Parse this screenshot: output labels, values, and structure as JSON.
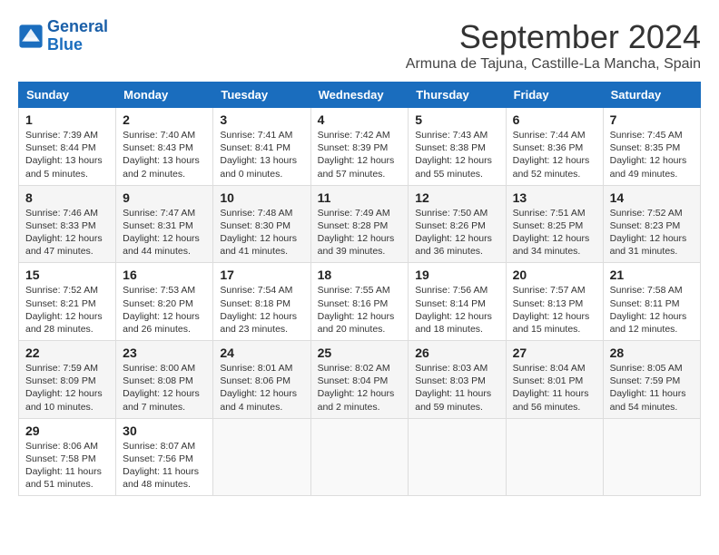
{
  "header": {
    "logo_line1": "General",
    "logo_line2": "Blue",
    "month_title": "September 2024",
    "location": "Armuna de Tajuna, Castille-La Mancha, Spain"
  },
  "days_of_week": [
    "Sunday",
    "Monday",
    "Tuesday",
    "Wednesday",
    "Thursday",
    "Friday",
    "Saturday"
  ],
  "weeks": [
    [
      {
        "day": "1",
        "info": "Sunrise: 7:39 AM\nSunset: 8:44 PM\nDaylight: 13 hours\nand 5 minutes."
      },
      {
        "day": "2",
        "info": "Sunrise: 7:40 AM\nSunset: 8:43 PM\nDaylight: 13 hours\nand 2 minutes."
      },
      {
        "day": "3",
        "info": "Sunrise: 7:41 AM\nSunset: 8:41 PM\nDaylight: 13 hours\nand 0 minutes."
      },
      {
        "day": "4",
        "info": "Sunrise: 7:42 AM\nSunset: 8:39 PM\nDaylight: 12 hours\nand 57 minutes."
      },
      {
        "day": "5",
        "info": "Sunrise: 7:43 AM\nSunset: 8:38 PM\nDaylight: 12 hours\nand 55 minutes."
      },
      {
        "day": "6",
        "info": "Sunrise: 7:44 AM\nSunset: 8:36 PM\nDaylight: 12 hours\nand 52 minutes."
      },
      {
        "day": "7",
        "info": "Sunrise: 7:45 AM\nSunset: 8:35 PM\nDaylight: 12 hours\nand 49 minutes."
      }
    ],
    [
      {
        "day": "8",
        "info": "Sunrise: 7:46 AM\nSunset: 8:33 PM\nDaylight: 12 hours\nand 47 minutes."
      },
      {
        "day": "9",
        "info": "Sunrise: 7:47 AM\nSunset: 8:31 PM\nDaylight: 12 hours\nand 44 minutes."
      },
      {
        "day": "10",
        "info": "Sunrise: 7:48 AM\nSunset: 8:30 PM\nDaylight: 12 hours\nand 41 minutes."
      },
      {
        "day": "11",
        "info": "Sunrise: 7:49 AM\nSunset: 8:28 PM\nDaylight: 12 hours\nand 39 minutes."
      },
      {
        "day": "12",
        "info": "Sunrise: 7:50 AM\nSunset: 8:26 PM\nDaylight: 12 hours\nand 36 minutes."
      },
      {
        "day": "13",
        "info": "Sunrise: 7:51 AM\nSunset: 8:25 PM\nDaylight: 12 hours\nand 34 minutes."
      },
      {
        "day": "14",
        "info": "Sunrise: 7:52 AM\nSunset: 8:23 PM\nDaylight: 12 hours\nand 31 minutes."
      }
    ],
    [
      {
        "day": "15",
        "info": "Sunrise: 7:52 AM\nSunset: 8:21 PM\nDaylight: 12 hours\nand 28 minutes."
      },
      {
        "day": "16",
        "info": "Sunrise: 7:53 AM\nSunset: 8:20 PM\nDaylight: 12 hours\nand 26 minutes."
      },
      {
        "day": "17",
        "info": "Sunrise: 7:54 AM\nSunset: 8:18 PM\nDaylight: 12 hours\nand 23 minutes."
      },
      {
        "day": "18",
        "info": "Sunrise: 7:55 AM\nSunset: 8:16 PM\nDaylight: 12 hours\nand 20 minutes."
      },
      {
        "day": "19",
        "info": "Sunrise: 7:56 AM\nSunset: 8:14 PM\nDaylight: 12 hours\nand 18 minutes."
      },
      {
        "day": "20",
        "info": "Sunrise: 7:57 AM\nSunset: 8:13 PM\nDaylight: 12 hours\nand 15 minutes."
      },
      {
        "day": "21",
        "info": "Sunrise: 7:58 AM\nSunset: 8:11 PM\nDaylight: 12 hours\nand 12 minutes."
      }
    ],
    [
      {
        "day": "22",
        "info": "Sunrise: 7:59 AM\nSunset: 8:09 PM\nDaylight: 12 hours\nand 10 minutes."
      },
      {
        "day": "23",
        "info": "Sunrise: 8:00 AM\nSunset: 8:08 PM\nDaylight: 12 hours\nand 7 minutes."
      },
      {
        "day": "24",
        "info": "Sunrise: 8:01 AM\nSunset: 8:06 PM\nDaylight: 12 hours\nand 4 minutes."
      },
      {
        "day": "25",
        "info": "Sunrise: 8:02 AM\nSunset: 8:04 PM\nDaylight: 12 hours\nand 2 minutes."
      },
      {
        "day": "26",
        "info": "Sunrise: 8:03 AM\nSunset: 8:03 PM\nDaylight: 11 hours\nand 59 minutes."
      },
      {
        "day": "27",
        "info": "Sunrise: 8:04 AM\nSunset: 8:01 PM\nDaylight: 11 hours\nand 56 minutes."
      },
      {
        "day": "28",
        "info": "Sunrise: 8:05 AM\nSunset: 7:59 PM\nDaylight: 11 hours\nand 54 minutes."
      }
    ],
    [
      {
        "day": "29",
        "info": "Sunrise: 8:06 AM\nSunset: 7:58 PM\nDaylight: 11 hours\nand 51 minutes."
      },
      {
        "day": "30",
        "info": "Sunrise: 8:07 AM\nSunset: 7:56 PM\nDaylight: 11 hours\nand 48 minutes."
      },
      null,
      null,
      null,
      null,
      null
    ]
  ]
}
